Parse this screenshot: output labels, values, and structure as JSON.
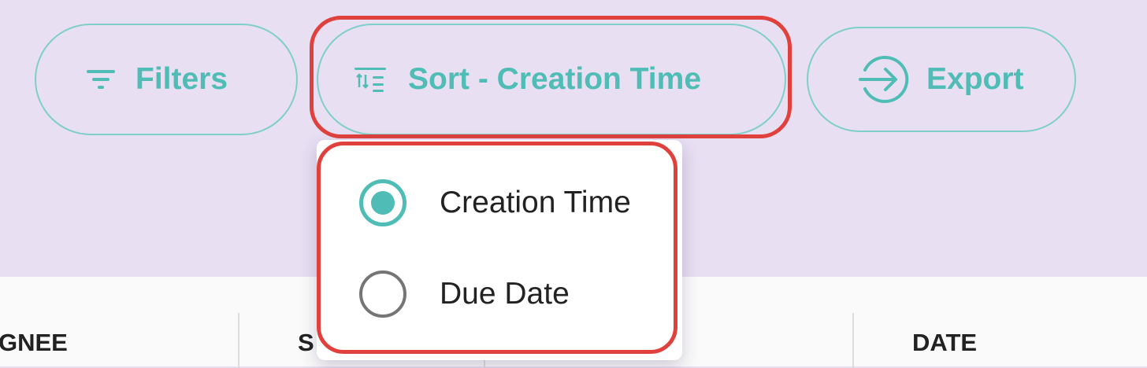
{
  "toolbar": {
    "filters_label": "Filters",
    "sort_label": "Sort - Creation Time",
    "export_label": "Export"
  },
  "sort_menu": {
    "options": [
      {
        "label": "Creation Time",
        "selected": true
      },
      {
        "label": "Due Date",
        "selected": false
      }
    ]
  },
  "table": {
    "columns": [
      {
        "label": "GNEE"
      },
      {
        "label": "S"
      },
      {
        "label": "DATE"
      }
    ]
  },
  "colors": {
    "accent": "#4fbdb5",
    "background": "#e8dff3",
    "highlight": "#e0413d"
  },
  "icons": {
    "filters": "filter-lines-icon",
    "sort": "sort-icon",
    "export": "export-arrow-icon"
  }
}
